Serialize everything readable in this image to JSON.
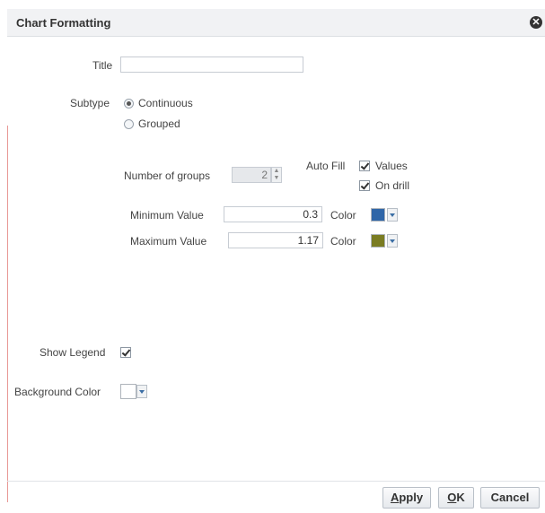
{
  "dialog": {
    "title": "Chart Formatting"
  },
  "title_field": {
    "label": "Title",
    "value": ""
  },
  "subtype": {
    "label": "Subtype",
    "options": [
      "Continuous",
      "Grouped"
    ],
    "selected": "Continuous"
  },
  "groups": {
    "label": "Number of groups",
    "value": "2"
  },
  "auto_fill": {
    "label": "Auto Fill",
    "values_label": "Values",
    "values_checked": true,
    "on_drill_label": "On drill",
    "on_drill_checked": true
  },
  "minimum": {
    "label": "Minimum Value",
    "value": "0.3",
    "color_label": "Color",
    "color": "#2f66a8"
  },
  "maximum": {
    "label": "Maximum Value",
    "value": "1.17",
    "color_label": "Color",
    "color": "#7a7c22"
  },
  "legend": {
    "label": "Show Legend",
    "checked": true
  },
  "background": {
    "label": "Background Color",
    "color": "#ffffff"
  },
  "buttons": {
    "apply": "Apply",
    "ok_rest": "K",
    "ok_mnemonic": "O",
    "cancel": "Cancel",
    "apply_mnemonic": "A",
    "apply_rest": "pply"
  }
}
